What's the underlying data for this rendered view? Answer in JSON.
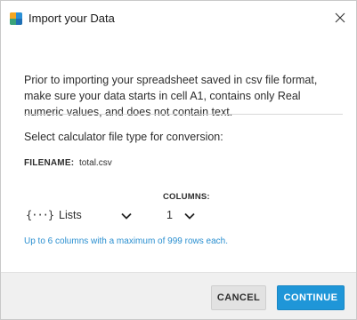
{
  "dialog": {
    "title": "Import your Data",
    "intro": "Prior to importing your spreadsheet saved in csv file format, make sure your data starts in cell A1, contains only Real numeric values, and does not contain text.",
    "select_label": "Select calculator file type for conversion:",
    "filename_label": "FILENAME:",
    "filename_value": "total.csv",
    "columns_label": "COLUMNS:",
    "file_type": {
      "icon_text": "{···}",
      "selected": "Lists"
    },
    "columns": {
      "selected": "1"
    },
    "hint": "Up to 6 columns with a maximum of 999 rows each.",
    "buttons": {
      "cancel": "CANCEL",
      "continue": "CONTINUE"
    }
  },
  "colors": {
    "accent": "#1f96d8",
    "hint_text": "#2a8fd0",
    "footer_bg": "#f0f0f0"
  },
  "icons": {
    "app": "ti-connect-app-icon",
    "close": "close-icon",
    "dropdown": "chevron-down-icon",
    "lists": "lists-braces-icon"
  }
}
